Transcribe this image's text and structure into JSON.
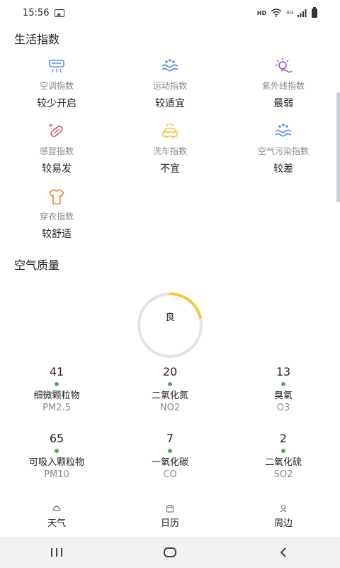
{
  "status_bar": {
    "time": "15:56",
    "hd": "HD",
    "net": "4G"
  },
  "life_section": {
    "title": "生活指数"
  },
  "life_indices": [
    {
      "icon": "air-conditioner-icon",
      "label": "空调指数",
      "value": "较少开启"
    },
    {
      "icon": "sport-icon",
      "label": "运动指数",
      "value": "较适宜"
    },
    {
      "icon": "uv-icon",
      "label": "紫外线指数",
      "value": "最弱"
    },
    {
      "icon": "cold-pill-icon",
      "label": "感冒指数",
      "value": "较易发"
    },
    {
      "icon": "car-wash-icon",
      "label": "洗车指数",
      "value": "不宜"
    },
    {
      "icon": "air-pollution-icon",
      "label": "空气污染指数",
      "value": "较差"
    },
    {
      "icon": "clothing-icon",
      "label": "穿衣指数",
      "value": "较舒适"
    }
  ],
  "air_section": {
    "title": "空气质量"
  },
  "aqi": {
    "level": "良"
  },
  "air_items": [
    {
      "value": "41",
      "name": "细微颗粒物",
      "code": "PM2.5"
    },
    {
      "value": "20",
      "name": "二氧化氮",
      "code": "NO2"
    },
    {
      "value": "13",
      "name": "臭氧",
      "code": "O3"
    },
    {
      "value": "65",
      "name": "可吸入颗粒物",
      "code": "PM10"
    },
    {
      "value": "7",
      "name": "一氧化碳",
      "code": "CO"
    },
    {
      "value": "2",
      "name": "二氧化硫",
      "code": "SO2"
    }
  ],
  "bottom_nav": [
    {
      "icon": "weather-icon",
      "label": "天气"
    },
    {
      "icon": "calendar-icon",
      "label": "日历"
    },
    {
      "icon": "nearby-icon",
      "label": "周边"
    }
  ],
  "colors": {
    "accent_yellow": "#f5c842",
    "ring_gray": "#e3e3e3",
    "good_green": "#4caf50",
    "icon_blue": "#5b8def",
    "icon_purple": "#a24fd6",
    "icon_red": "#e0506a",
    "icon_orange": "#f08a3c"
  }
}
